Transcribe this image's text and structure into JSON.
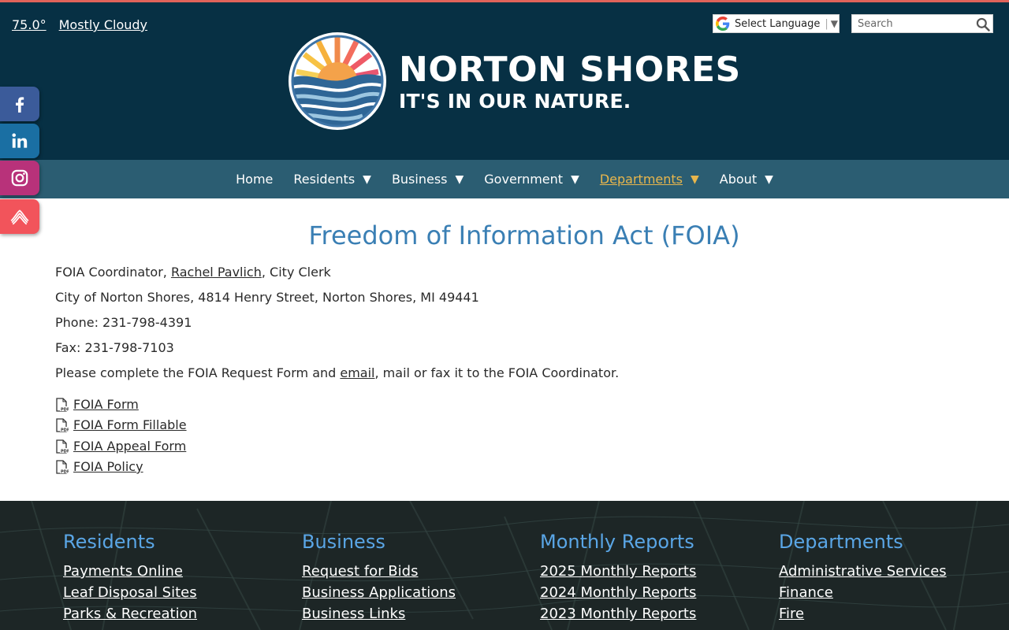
{
  "weather": {
    "temp": "75.0°",
    "condition": "Mostly Cloudy"
  },
  "translate": {
    "label": "Select Language",
    "arrow": "▼",
    "icon": "google-icon"
  },
  "search": {
    "placeholder": "Search",
    "icon": "search-icon"
  },
  "brand": {
    "name": "NORTON SHORES",
    "tagline": "IT'S IN OUR NATURE."
  },
  "nav": [
    {
      "label": "Home",
      "caret": ""
    },
    {
      "label": "Residents",
      "caret": "▼"
    },
    {
      "label": "Business",
      "caret": "▼"
    },
    {
      "label": "Government",
      "caret": "▼"
    },
    {
      "label": "Departments",
      "caret": "▼",
      "active": true
    },
    {
      "label": "About",
      "caret": "▼"
    }
  ],
  "social": [
    {
      "icon": "facebook-icon",
      "color": "#3b5b9a"
    },
    {
      "icon": "linkedin-icon",
      "color": "#1a6fa3"
    },
    {
      "icon": "instagram-icon",
      "color": "#b8327a"
    },
    {
      "icon": "swoosh-icon",
      "color": "#f2545b"
    }
  ],
  "page": {
    "title": "Freedom of Information Act (FOIA)",
    "coordinator_prefix": "FOIA Coordinator, ",
    "coordinator_name": "Rachel Pavlich",
    "coordinator_suffix": ", City Clerk",
    "address": "City of Norton Shores, 4814 Henry Street, Norton Shores, MI 49441",
    "phone": "Phone: 231-798-4391",
    "fax": "Fax: 231-798-7103",
    "instructions_prefix": "Please complete the FOIA Request Form and ",
    "instructions_link": "email",
    "instructions_suffix": ", mail or fax it to the FOIA Coordinator.",
    "documents": [
      "FOIA Form",
      "FOIA Form Fillable",
      "FOIA Appeal Form",
      "FOIA Policy"
    ]
  },
  "footer": {
    "columns": [
      {
        "heading": "Residents",
        "links": [
          "Payments Online",
          "Leaf Disposal Sites",
          "Parks & Recreation"
        ]
      },
      {
        "heading": "Business",
        "links": [
          "Request for Bids",
          "Business Applications",
          "Business Links"
        ]
      },
      {
        "heading": "Monthly Reports",
        "links": [
          "2025 Monthly Reports",
          "2024 Monthly Reports",
          "2023 Monthly Reports"
        ]
      },
      {
        "heading": "Departments",
        "links": [
          "Administrative Services",
          "Finance",
          "Fire"
        ]
      }
    ]
  },
  "colors": {
    "header_bg": "#073044",
    "nav_bg": "#2b5d72",
    "nav_active": "#e8b64c",
    "title": "#3a7fb4",
    "footer_heading": "#5aa6e6"
  }
}
